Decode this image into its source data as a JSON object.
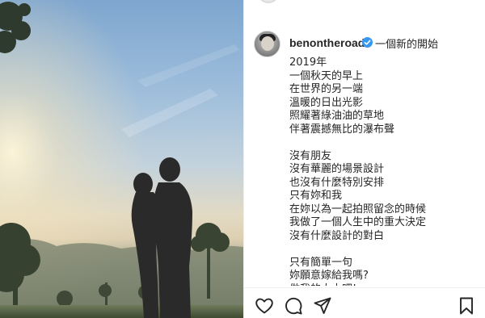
{
  "post": {
    "username": "benontheroad",
    "header_caption": "一個新的開始",
    "caption_lines": [
      "2019年",
      "一個秋天的早上",
      "在世界的另一端",
      "溫暖的日出光影",
      "照耀著綠油油的草地",
      "伴著震撼無比的瀑布聲",
      "",
      "沒有朋友",
      "沒有華麗的場景設計",
      "也沒有什麼特別安排",
      "只有妳和我",
      "在妳以為一起拍照留念的時候",
      "我做了一個人生中的重大決定",
      "沒有什麼設計的對白",
      "",
      "只有簡單一句",
      "妳願意嫁給我嗎?",
      "做我的太太吧!"
    ]
  },
  "icons": {
    "verified": "verified-badge-icon",
    "like": "heart-icon",
    "comment": "comment-icon",
    "share": "paper-plane-icon",
    "save": "bookmark-icon"
  },
  "colors": {
    "accent_verified": "#3897f0",
    "text": "#262626",
    "divider": "#efefef"
  }
}
